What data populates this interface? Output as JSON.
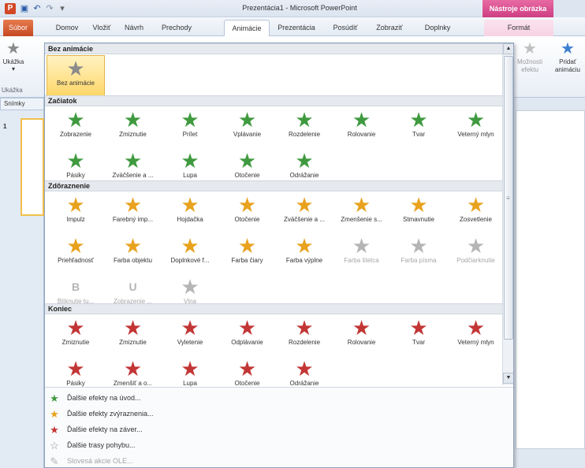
{
  "window": {
    "title": "Prezentácia1 - Microsoft PowerPoint",
    "context_tab": "Nástroje obrázka",
    "app_icon": "P"
  },
  "tabs": [
    {
      "label": "Súbor",
      "kind": "file"
    },
    {
      "label": "Domov"
    },
    {
      "label": "Vložiť"
    },
    {
      "label": "Návrh"
    },
    {
      "label": "Prechody"
    },
    {
      "label": "Animácie",
      "kind": "active"
    },
    {
      "label": "Prezentácia"
    },
    {
      "label": "Posúdiť"
    },
    {
      "label": "Zobraziť"
    },
    {
      "label": "Doplnky"
    },
    {
      "label": "Formát",
      "kind": "format"
    }
  ],
  "ribbon": {
    "preview_label": "Ukážka",
    "preview_group": "Ukážka",
    "effect_options": "Možnosti efektu",
    "add_animation": "Pridať animáciu"
  },
  "left_pane": {
    "tab_label": "Snímky",
    "slide_number": "1"
  },
  "gallery": {
    "sections": {
      "none": "Bez animácie",
      "entrance": "Začiatok",
      "emphasis": "Zdôraznenie",
      "exit": "Koniec"
    },
    "none_items": [
      {
        "label": "Bez animácie",
        "icon": "plain-star",
        "color": "#9b9b9b"
      }
    ],
    "entrance_items": [
      {
        "label": "Zobrazenie",
        "icon": "star"
      },
      {
        "label": "Zmiznutie",
        "icon": "star"
      },
      {
        "label": "Prílet",
        "icon": "star"
      },
      {
        "label": "Vplávanie",
        "icon": "star"
      },
      {
        "label": "Rozdelenie",
        "icon": "star"
      },
      {
        "label": "Rolovanie",
        "icon": "star"
      },
      {
        "label": "Tvar",
        "icon": "star"
      },
      {
        "label": "Veterný mlyn",
        "icon": "star"
      },
      {
        "label": "Pásiky",
        "icon": "star"
      },
      {
        "label": "Zväčšenie a ...",
        "icon": "star"
      },
      {
        "label": "Lupa",
        "icon": "star"
      },
      {
        "label": "Otočenie",
        "icon": "star"
      },
      {
        "label": "Odrážanie",
        "icon": "star"
      }
    ],
    "emphasis_items": [
      {
        "label": "Impulz",
        "disabled": false
      },
      {
        "label": "Farebný imp...",
        "disabled": false
      },
      {
        "label": "Hojdačka",
        "disabled": false
      },
      {
        "label": "Otočenie",
        "disabled": false
      },
      {
        "label": "Zväčšenie a ...",
        "disabled": false
      },
      {
        "label": "Zmenšenie s...",
        "disabled": false
      },
      {
        "label": "Stmavnutie",
        "disabled": false
      },
      {
        "label": "Zosvetlenie",
        "disabled": false
      },
      {
        "label": "Priehľadnosť",
        "disabled": false
      },
      {
        "label": "Farba objektu",
        "disabled": false
      },
      {
        "label": "Doplnkové f...",
        "disabled": false
      },
      {
        "label": "Farba čiary",
        "disabled": false
      },
      {
        "label": "Farba výplne",
        "disabled": false
      },
      {
        "label": "Farba štetca",
        "disabled": true
      },
      {
        "label": "Farba písma",
        "disabled": true
      },
      {
        "label": "Podčiarknutie",
        "disabled": true
      },
      {
        "label": "Blíknutie tu...",
        "disabled": true
      },
      {
        "label": "Zobrazenie ...",
        "disabled": true
      },
      {
        "label": "Vlna",
        "disabled": true
      }
    ],
    "exit_items": [
      {
        "label": "Zmiznutie"
      },
      {
        "label": "Zmiznutie"
      },
      {
        "label": "Vyletenie"
      },
      {
        "label": "Odplávanie"
      },
      {
        "label": "Rozdelenie"
      },
      {
        "label": "Rolovanie"
      },
      {
        "label": "Tvar"
      },
      {
        "label": "Veterný mlyn"
      },
      {
        "label": "Pásiky"
      },
      {
        "label": "Zmenšiť a o..."
      },
      {
        "label": "Lupa"
      },
      {
        "label": "Otočenie"
      },
      {
        "label": "Odrážanie"
      }
    ],
    "emphasis_letters": {
      "bold": "B",
      "underline": "U"
    }
  },
  "menu": [
    {
      "label": "Ďalšie efekty na úvod...",
      "icon": "green-star-icon",
      "disabled": false
    },
    {
      "label": "Ďalšie efekty zvýraznenia...",
      "icon": "gold-star-icon",
      "disabled": false
    },
    {
      "label": "Ďalšie efekty na záver...",
      "icon": "red-star-icon",
      "disabled": false
    },
    {
      "label": "Ďalšie trasy pohybu...",
      "icon": "outline-star-icon",
      "disabled": false
    },
    {
      "label": "Slovesá akcie OLE...",
      "icon": "ole-icon",
      "disabled": true
    }
  ],
  "colors": {
    "entrance": "#3f9a3f",
    "emphasis": "#e8a21e",
    "exit": "#c33535",
    "file_tab": "#c54820",
    "context_tab": "#cf3d83",
    "selection": "#ffd76a"
  }
}
